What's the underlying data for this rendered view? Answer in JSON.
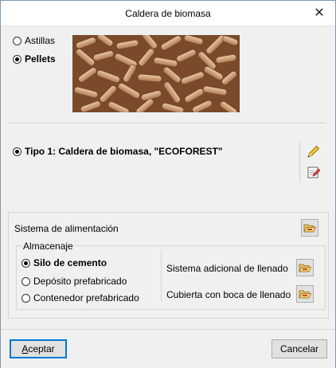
{
  "window": {
    "title": "Caldera de biomasa",
    "close_glyph": "✕"
  },
  "fuel": {
    "options": [
      {
        "label": "Astillas",
        "selected": false
      },
      {
        "label": "Pellets",
        "selected": true
      }
    ],
    "image_icon": "wood-pellets-photo"
  },
  "type_option": {
    "label": "Tipo 1: Caldera de biomasa, \"ECOFOREST\"",
    "selected": true
  },
  "tools": {
    "edit_icon": "pencil-icon",
    "edit_list_icon": "edit-document-icon"
  },
  "feed_system": {
    "label": "Sistema de alimentación",
    "button_icon": "open-folder-icon"
  },
  "storage": {
    "legend": "Almacenaje",
    "options": [
      {
        "label": "Silo de cemento",
        "selected": true
      },
      {
        "label": "Depósito prefabricado",
        "selected": false
      },
      {
        "label": "Contenedor prefabricado",
        "selected": false
      }
    ],
    "extra_fill": "Sistema adicional de llenado",
    "cover": "Cubierta con boca de llenado"
  },
  "footer": {
    "accept": "Aceptar",
    "accept_underline": "A",
    "accept_rest": "ceptar",
    "cancel": "Cancelar"
  }
}
